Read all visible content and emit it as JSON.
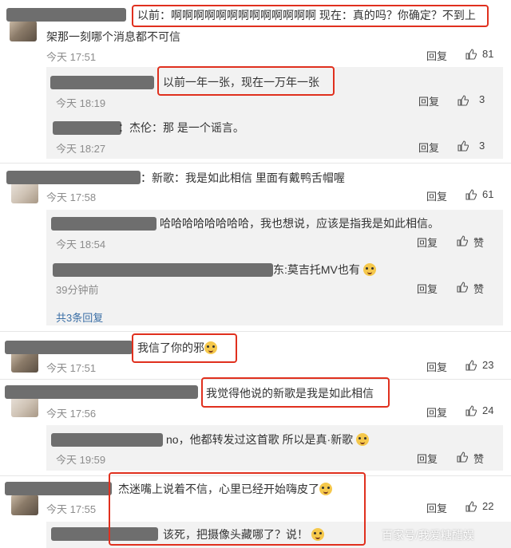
{
  "comments": [
    {
      "text_line1": "以前：啊啊啊啊啊啊啊啊啊啊啊啊啊 现在：真的吗？你确定？不到上",
      "text_line2": "架那一刻哪个消息都不可信",
      "time": "今天 17:51",
      "reply_label": "回复",
      "likes": "81",
      "replies": [
        {
          "text": "以前一年一张，现在一万年一张",
          "time": "今天 18:19",
          "reply_label": "回复",
          "likes": "3"
        },
        {
          "text": "：杰伦：那 是一个谣言。",
          "time": "今天 18:27",
          "reply_label": "回复",
          "likes": "3"
        }
      ]
    },
    {
      "text_line1": "：新歌：我是如此相信 里面有戴鸭舌帽喔",
      "time": "今天 17:58",
      "reply_label": "回复",
      "likes": "61",
      "replies": [
        {
          "text": "哈哈哈哈哈哈哈哈，我也想说，应该是指我是如此相信。",
          "time": "今天 18:54",
          "reply_label": "回复",
          "likes": "赞"
        },
        {
          "text": "东:莫吉托MV也有",
          "time": "39分钟前",
          "reply_label": "回复",
          "likes": "赞"
        }
      ],
      "more_replies": "共3条回复"
    },
    {
      "text_line1": "我信了你的邪",
      "time": "今天 17:51",
      "reply_label": "回复",
      "likes": "23"
    },
    {
      "text_line1": "我觉得他说的新歌是我是如此相信",
      "time": "今天 17:56",
      "reply_label": "回复",
      "likes": "24",
      "replies": [
        {
          "text": "no，他都转发过这首歌 所以是真·新歌",
          "time": "今天 19:59",
          "reply_label": "回复",
          "likes": "赞"
        }
      ]
    },
    {
      "text_line1": "杰迷嘴上说着不信，心里已经开始嗨皮了",
      "time": "今天 17:55",
      "reply_label": "回复",
      "likes": "22",
      "replies": [
        {
          "text": "该死，把摄像头藏哪了？说！"
        }
      ]
    }
  ],
  "watermark": "百家号/我爱糖醋娱",
  "colors": {
    "highlight": "#e0301e",
    "link": "#3b6fa6",
    "reply_bg": "#f2f2f2"
  }
}
